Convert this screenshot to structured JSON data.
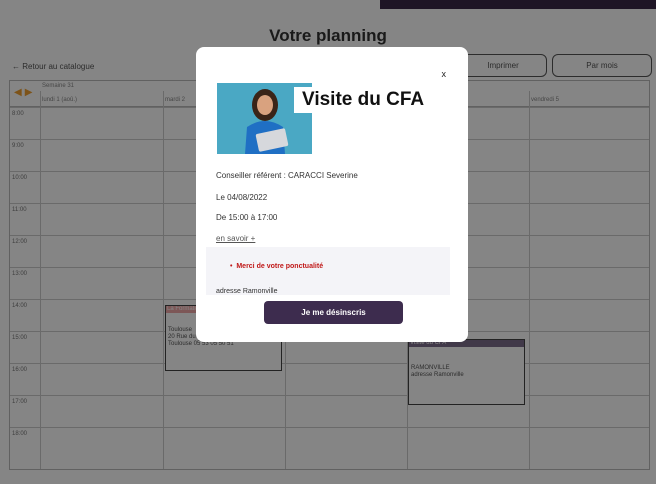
{
  "page": {
    "title": "Votre planning",
    "back_label": "← Retour au catalogue",
    "print_label": "Imprimer",
    "month_label": "Par mois"
  },
  "calendar": {
    "week_label": "Semaine 31",
    "days": [
      "lundi 1 (aoû.)",
      "mardi 2",
      "vendredi 5"
    ],
    "hours": [
      "8:00",
      "9:00",
      "10:00",
      "11:00",
      "12:00",
      "13:00",
      "14:00",
      "15:00",
      "16:00",
      "17:00",
      "18:00"
    ],
    "events": [
      {
        "header": "La Formation",
        "lines": [
          "Toulouse",
          "20 Rue du Général Leclerc 31000",
          "Toulouse 05 53 05 50 51"
        ],
        "color": "#f0a8a8"
      },
      {
        "header": "Visite du CFA",
        "lines": [
          "RAMONVILLE",
          "adresse Ramonville"
        ],
        "color": "#7e6e8c"
      }
    ]
  },
  "modal": {
    "close": "x",
    "title": "Visite du CFA",
    "advisor": "Conseiller référent : CARACCI Severine",
    "date": "Le 04/08/2022",
    "time": "De 15:00 à 17:00",
    "more": "en savoir +",
    "note": "Merci de votre ponctualité",
    "address": "adresse Ramonville",
    "action": "Je me désinscris"
  },
  "colors": {
    "accent": "#3d2c4e",
    "note": "#c01818"
  }
}
